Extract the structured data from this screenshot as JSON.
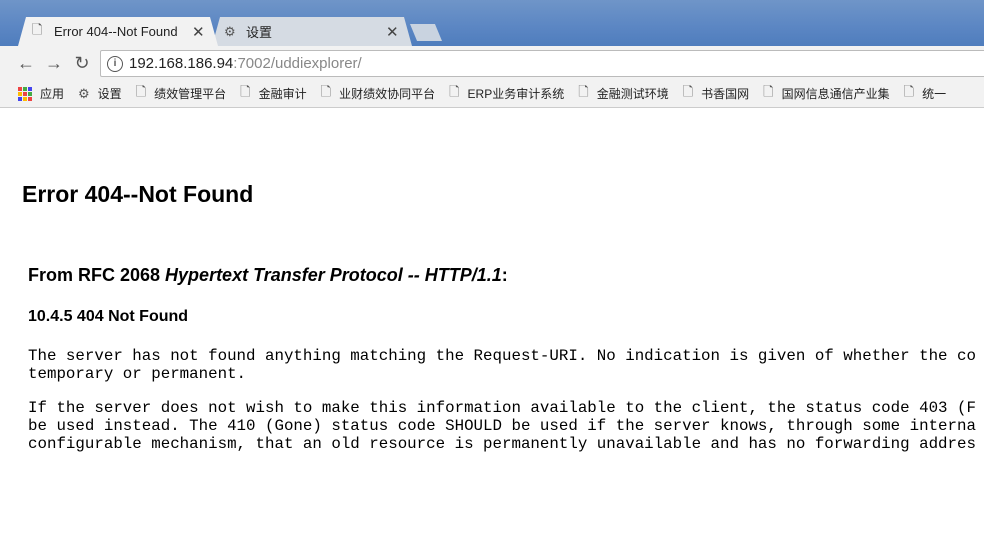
{
  "browser": {
    "tabs": [
      {
        "title": "Error 404--Not Found",
        "icon": "page-icon"
      },
      {
        "title": "设置",
        "icon": "gear-icon"
      }
    ],
    "url": {
      "host": "192.168.186.94",
      "path": ":7002/uddiexplorer/"
    },
    "bookmarks": [
      {
        "label": "应用",
        "icon": "apps-icon"
      },
      {
        "label": "设置",
        "icon": "gear-icon"
      },
      {
        "label": "绩效管理平台",
        "icon": "page-icon"
      },
      {
        "label": "金融审计",
        "icon": "page-icon"
      },
      {
        "label": "业财绩效协同平台",
        "icon": "page-icon"
      },
      {
        "label": "ERP业务审计系统",
        "icon": "page-icon"
      },
      {
        "label": "金融测试环境",
        "icon": "page-icon"
      },
      {
        "label": "书香国网",
        "icon": "page-icon"
      },
      {
        "label": "国网信息通信产业集",
        "icon": "page-icon"
      },
      {
        "label": "统一",
        "icon": "page-icon"
      }
    ]
  },
  "page": {
    "title": "Error 404--Not Found",
    "rfc_prefix": "From RFC 2068 ",
    "rfc_italic": "Hypertext Transfer Protocol -- HTTP/1.1",
    "rfc_suffix": ":",
    "section": "10.4.5 404 Not Found",
    "para1": [
      "The server has not found anything matching the Request-URI. No indication is given of whether the co",
      "temporary or permanent."
    ],
    "para2": [
      "If the server does not wish to make this information available to the client, the status code 403 (F",
      "be used instead. The 410 (Gone) status code SHOULD be used if the server knows, through some interna",
      "configurable mechanism, that an old resource is permanently unavailable and has no forwarding addres"
    ]
  }
}
